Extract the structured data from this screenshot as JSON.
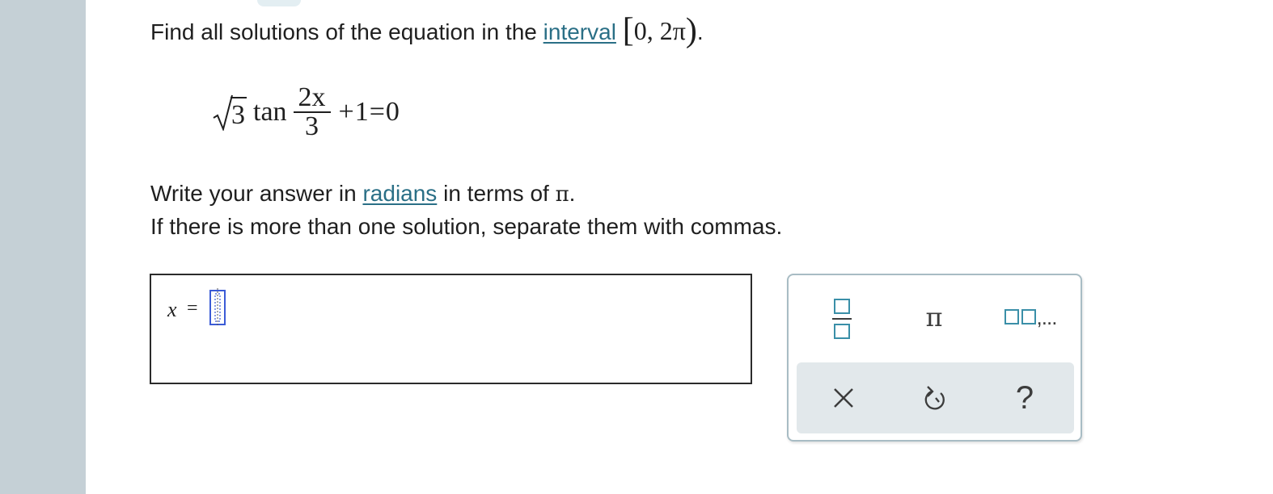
{
  "question": {
    "prompt_before_link": "Find all solutions of the equation in the ",
    "interval_link": "interval",
    "interval_open": "[",
    "interval_values": "0, 2π",
    "interval_close": ")",
    "interval_period": ".",
    "equation": {
      "radicand": "3",
      "function": "tan",
      "numerator": "2x",
      "denominator": "3",
      "rest": "+1=0"
    },
    "instruction1_before_link": "Write your answer in ",
    "radians_link": "radians",
    "instruction1_after_link": " in terms of ",
    "pi_symbol": "π",
    "instruction1_end": ".",
    "instruction2": "If there is more than one solution, separate them with commas."
  },
  "answer": {
    "variable": "x",
    "equals": "=",
    "value": ""
  },
  "toolpad": {
    "pi_label": "π",
    "list_label": ",...",
    "clear_label": "clear",
    "undo_label": "undo",
    "help_label": "?"
  },
  "colors": {
    "link": "#2a6f86",
    "rail": "#c5d0d6",
    "toolpad_border": "#a8bcc4",
    "toolpad_row2": "#e2e8eb",
    "cursor_blue": "#3b5bd6",
    "icon_teal": "#3a8fa8"
  },
  "icons": [
    "fraction-icon",
    "pi-icon",
    "list-icon",
    "close-icon",
    "undo-icon",
    "help-icon"
  ]
}
